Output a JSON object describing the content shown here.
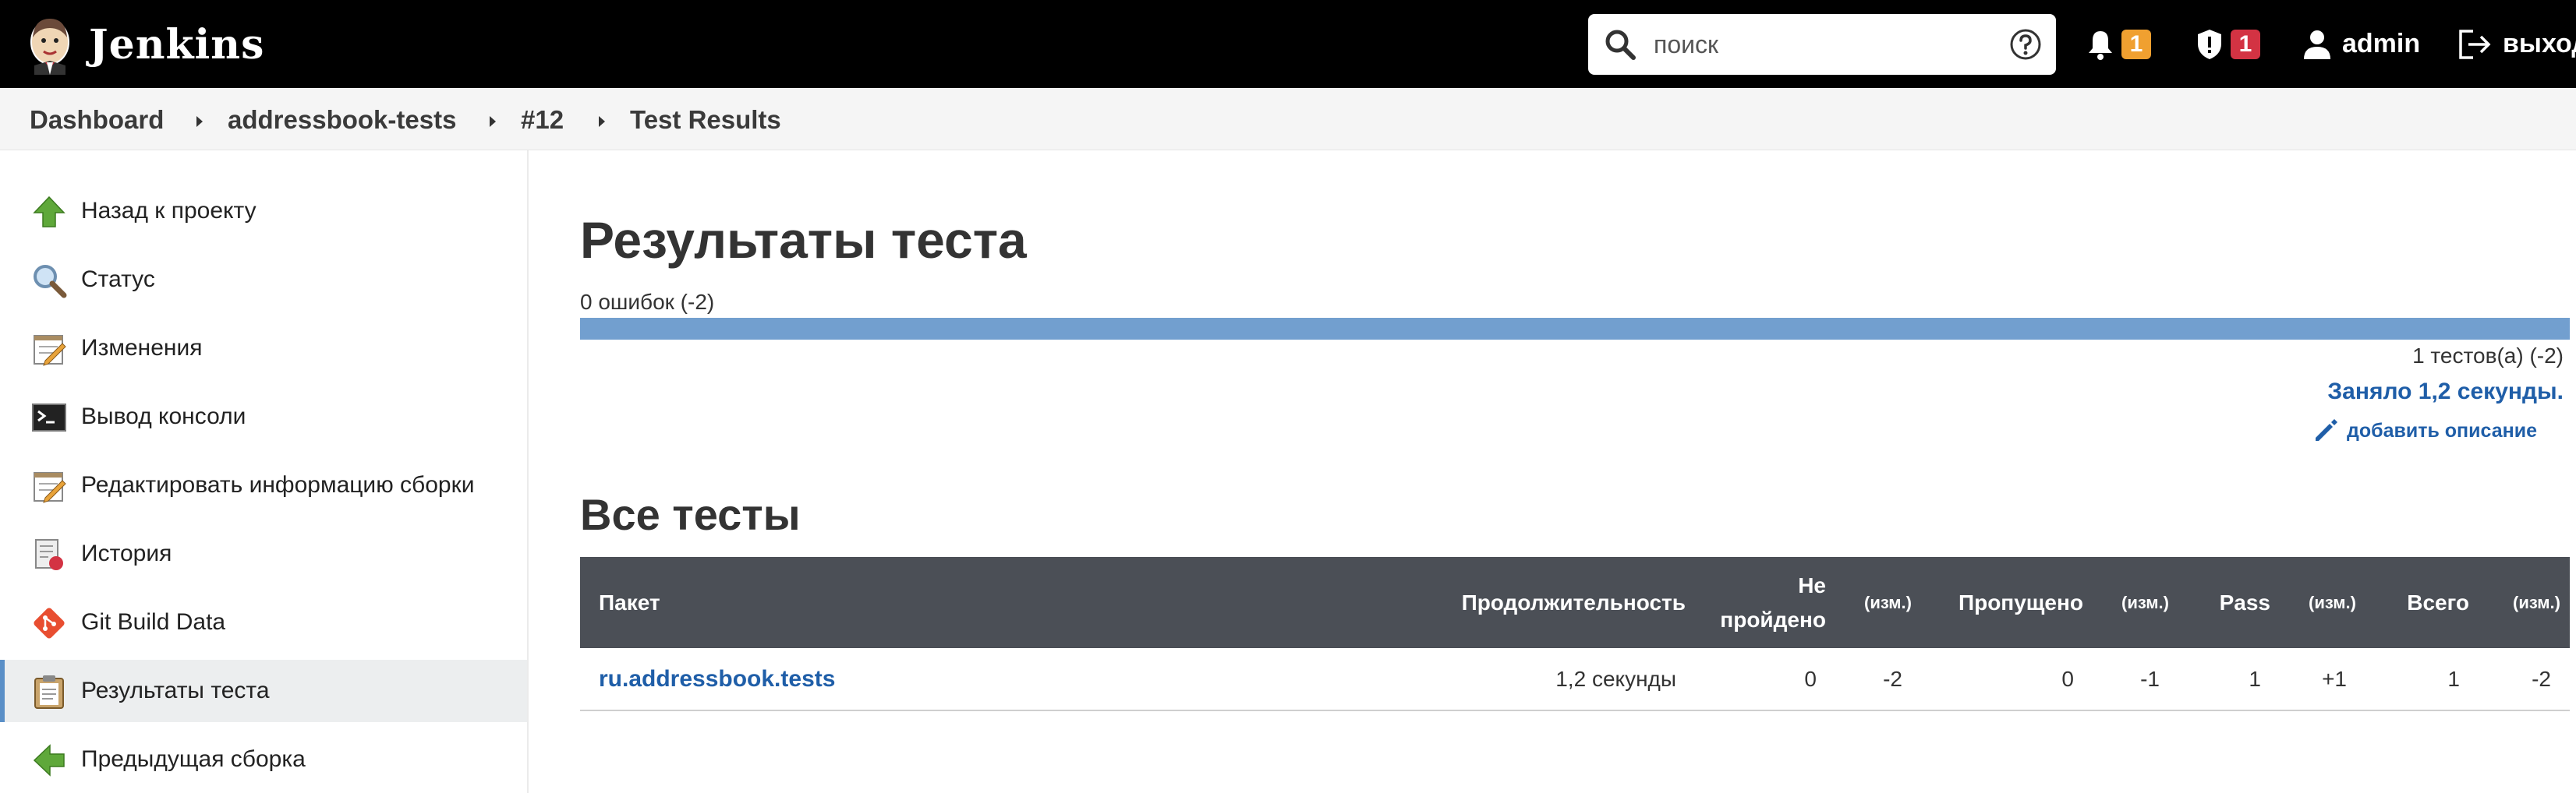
{
  "header": {
    "app_name": "Jenkins",
    "search_placeholder": "поиск",
    "notifications_count": "1",
    "security_count": "1",
    "user": "admin",
    "logout": "выход"
  },
  "breadcrumb": [
    "Dashboard",
    "addressbook-tests",
    "#12",
    "Test Results"
  ],
  "sidebar": {
    "items": [
      {
        "label": "Назад к проекту",
        "icon": "up-arrow-icon"
      },
      {
        "label": "Статус",
        "icon": "magnifier-icon"
      },
      {
        "label": "Изменения",
        "icon": "notepad-icon"
      },
      {
        "label": "Вывод консоли",
        "icon": "terminal-icon"
      },
      {
        "label": "Редактировать информацию сборки",
        "icon": "notepad-edit-icon"
      },
      {
        "label": "История",
        "icon": "history-icon"
      },
      {
        "label": "Git Build Data",
        "icon": "git-icon"
      },
      {
        "label": "Результаты теста",
        "icon": "clipboard-icon",
        "active": true
      },
      {
        "label": "Предыдущая сборка",
        "icon": "left-arrow-icon"
      }
    ]
  },
  "main": {
    "title": "Результаты теста",
    "failures": "0 ошибок (-2)",
    "pass_fraction": 1.0,
    "tests_count": "1 тестов(а) (-2)",
    "took": "Заняло 1,2 секунды.",
    "add_description": "добавить описание",
    "all_tests_title": "Все тесты"
  },
  "table": {
    "headers": {
      "package": "Пакет",
      "duration": "Продолжительность",
      "failed_1": "Не",
      "failed_2": "пройдено",
      "diff": "(изм.)",
      "skipped": "Пропущено",
      "pass": "Pass",
      "total": "Всего"
    },
    "rows": [
      {
        "package": "ru.addressbook.tests",
        "duration": "1,2 секунды",
        "failed": "0",
        "failed_diff": "-2",
        "skipped": "0",
        "skipped_diff": "-1",
        "pass": "1",
        "pass_diff": "+1",
        "total": "1",
        "total_diff": "-2"
      }
    ]
  },
  "colors": {
    "header_bg": "#000000",
    "link": "#1f5ea8",
    "progress_pass": "#729fcf",
    "table_header_bg": "#4b4f56",
    "badge_orange": "#f0a030",
    "badge_red": "#d33343"
  }
}
